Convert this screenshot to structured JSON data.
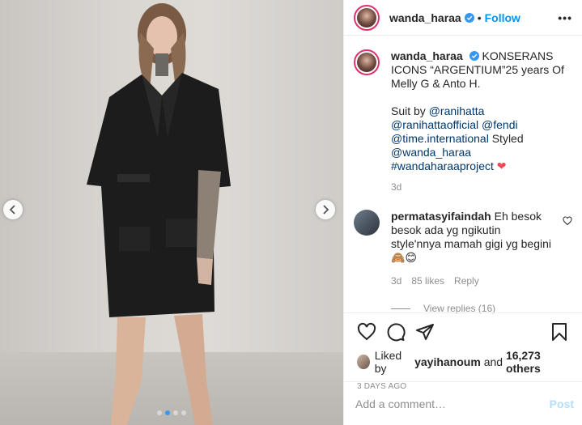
{
  "colors": {
    "accent": "#0095f6",
    "heart": "#ed4956",
    "muted": "#8e8e8e",
    "link": "#00376b"
  },
  "post": {
    "username": "wanda_haraa",
    "follow_label": "Follow",
    "more_label": "•••",
    "caption": {
      "text_1": "KONSERANS ICONS “ARGENTIUM”25 years Of Melly G & Anto H.",
      "suit_by": "Suit by",
      "mentions_1": [
        "@ranihatta",
        "@ranihattaofficial",
        "@fendi",
        "@time.international"
      ],
      "styled": "Styled",
      "styled_mention": "@wanda_haraa",
      "hashtag": "#wandaharaaproject"
    },
    "caption_age": "3d",
    "carousel": {
      "slides": 4,
      "active": 2
    }
  },
  "comment": {
    "username": "permatasyifaindah",
    "text": "Eh besok besok ada yg ngikutin style'nnya mamah gigi yg begini",
    "emojis": "🙈😊",
    "age": "3d",
    "likes": "85 likes",
    "reply_label": "Reply",
    "view_replies": "View replies (16)"
  },
  "actions": {
    "liked_by_prefix": "Liked by",
    "liked_by_user": "yayihanoum",
    "liked_by_and": "and",
    "liked_by_count": "16,273 others",
    "timestamp": "3 DAYS AGO"
  },
  "composer": {
    "placeholder": "Add a comment…",
    "post_label": "Post"
  },
  "icons": {
    "prev": "chevron-left-icon",
    "next": "chevron-right-icon",
    "verified": "verified-badge-icon",
    "like": "heart-icon",
    "comment": "comment-icon",
    "share": "paper-plane-icon",
    "save": "bookmark-icon"
  }
}
